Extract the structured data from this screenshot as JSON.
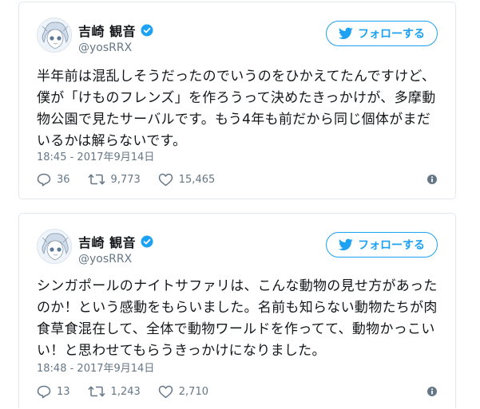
{
  "tweets": [
    {
      "display_name": "吉崎 観音",
      "handle": "@yosRRX",
      "follow_label": "フォローする",
      "text": "半年前は混乱しそうだったのでいうのをひかえてたんですけど、僕が「けものフレンズ」を作ろうって決めたきっかけが、多摩動物公園で見たサーバルです。もう4年も前だから同じ個体がまだいるかは解らないです。",
      "timestamp": "18:45 - 2017年9月14日",
      "replies": "36",
      "retweets": "9,773",
      "likes": "15,465"
    },
    {
      "display_name": "吉崎 観音",
      "handle": "@yosRRX",
      "follow_label": "フォローする",
      "text": "シンガポールのナイトサファリは、こんな動物の見せ方があったのか！という感動をもらいました。名前も知らない動物たちが肉食草食混在して、全体で動物ワールドを作ってて、動物かっこいい！と思わせてもらうきっかけになりました。",
      "timestamp": "18:48 - 2017年9月14日",
      "replies": "13",
      "retweets": "1,243",
      "likes": "2,710"
    }
  ],
  "icons": {
    "verified": "verified-badge-icon",
    "bird": "twitter-bird-icon",
    "reply": "reply-icon",
    "retweet": "retweet-icon",
    "like": "heart-icon",
    "info": "info-icon"
  },
  "colors": {
    "accent": "#1da1f2",
    "text": "#14171a",
    "muted": "#657786",
    "border": "#e1e8ed"
  }
}
